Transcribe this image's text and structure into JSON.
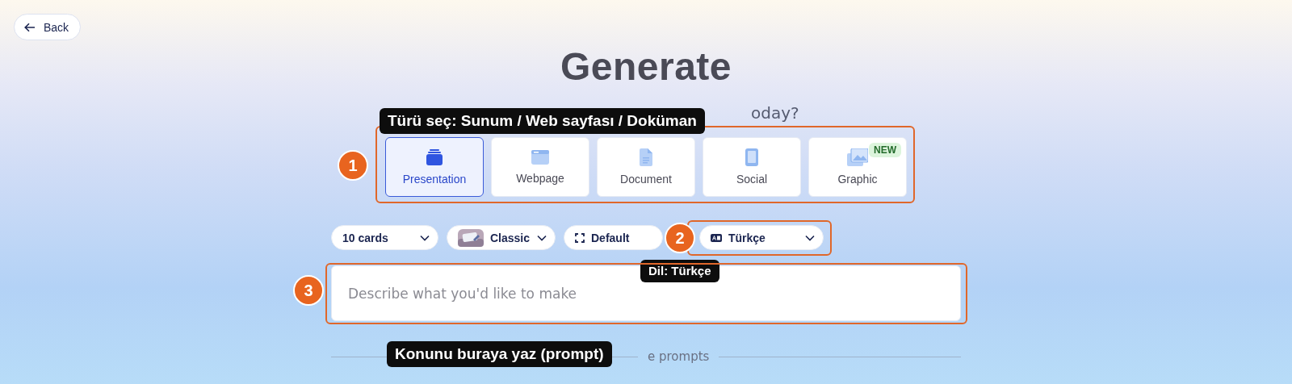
{
  "back_button": {
    "label": "Back"
  },
  "title": "Generate",
  "subtitle_visible": "oday?",
  "content_types": [
    {
      "kind": "presentation",
      "label": "Presentation",
      "selected": true
    },
    {
      "kind": "webpage",
      "label": "Webpage",
      "selected": false
    },
    {
      "kind": "document",
      "label": "Document",
      "selected": false
    },
    {
      "kind": "social",
      "label": "Social",
      "selected": false
    },
    {
      "kind": "graphic",
      "label": "Graphic",
      "selected": false,
      "badge": "NEW"
    }
  ],
  "options": [
    {
      "kind": "count",
      "label": "10 cards",
      "caret": true
    },
    {
      "kind": "theme",
      "label": "Classic",
      "caret": true
    },
    {
      "kind": "format",
      "label": "Default",
      "caret": false
    },
    {
      "kind": "language",
      "label": "Türkçe",
      "caret": true
    }
  ],
  "prompt": {
    "placeholder": "Describe what you'd like to make"
  },
  "divider_visible": "e prompts",
  "annotations": [
    {
      "number": "1",
      "note": "Türü seç: Sunum / Web sayfası / Doküman"
    },
    {
      "number": "2",
      "note": "Dil: Türkçe"
    },
    {
      "number": "3",
      "note": "Konunu buraya yaz (prompt)"
    }
  ]
}
